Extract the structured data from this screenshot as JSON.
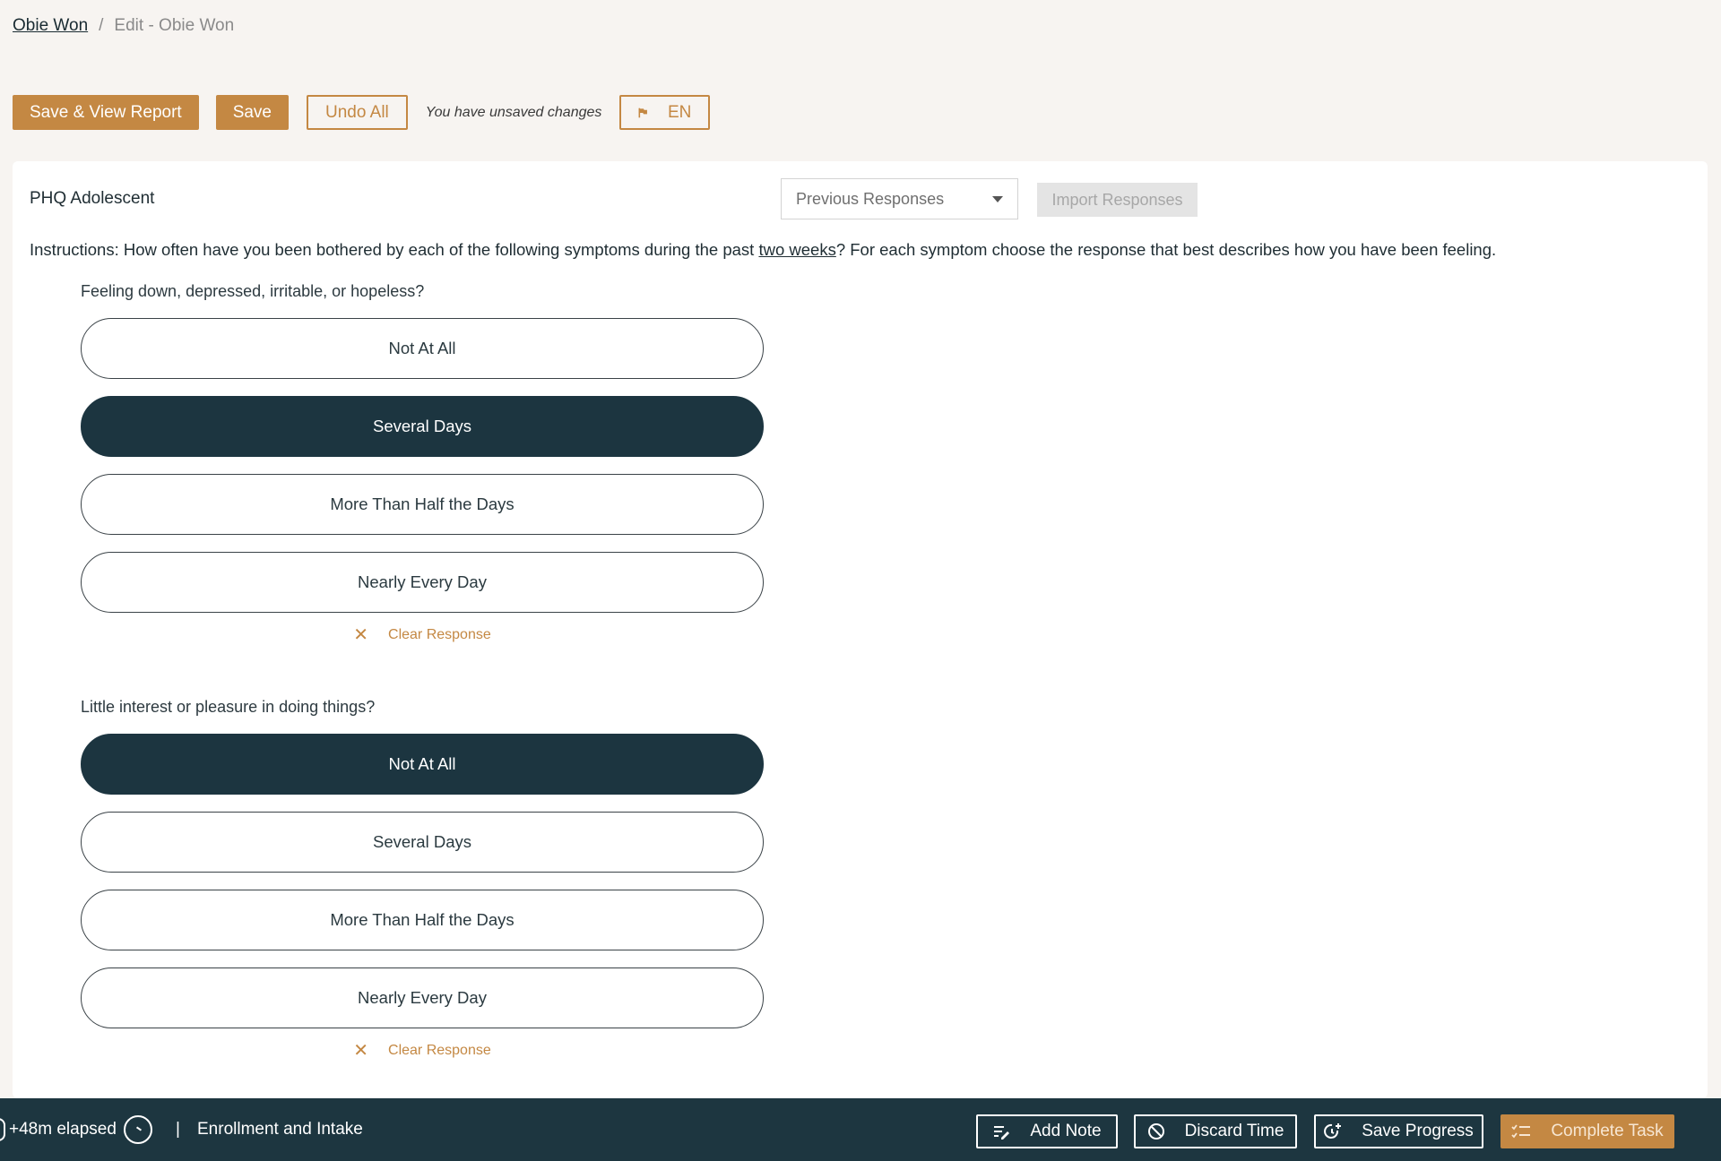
{
  "breadcrumb": {
    "patient_link": "Obie Won",
    "separator": "/",
    "current": "Edit - Obie Won"
  },
  "toolbar": {
    "save_view_report": "Save & View Report",
    "save": "Save",
    "undo_all": "Undo All",
    "unsaved_text": "You have unsaved changes",
    "language": "EN",
    "language_icon": "flag-icon"
  },
  "assessment": {
    "title": "PHQ Adolescent",
    "previous_responses_placeholder": "Previous Responses",
    "import_responses": "Import Responses",
    "instructions_before": "Instructions: How often have you been bothered by each of the following symptoms during the past ",
    "instructions_underline": "two weeks",
    "instructions_after": "? For each symptom choose the response that best describes how you have been feeling.",
    "questions": [
      {
        "text": "Feeling down, depressed, irritable, or hopeless?",
        "options": [
          "Not At All",
          "Several Days",
          "More Than Half the Days",
          "Nearly Every Day"
        ],
        "selected": "Several Days",
        "clear_label": "Clear Response"
      },
      {
        "text": "Little interest or pleasure in doing things?",
        "options": [
          "Not At All",
          "Several Days",
          "More Than Half the Days",
          "Nearly Every Day"
        ],
        "selected": "Not At All",
        "clear_label": "Clear Response"
      }
    ]
  },
  "footer": {
    "elapsed": "+48m elapsed",
    "separator": "|",
    "workflow": "Enrollment and Intake",
    "add_note": "Add Note",
    "discard_time": "Discard Time",
    "save_progress": "Save Progress",
    "complete_task": "Complete Task"
  },
  "colors": {
    "accent": "#c48843",
    "dark": "#1c3540",
    "background": "#f7f4f1"
  }
}
